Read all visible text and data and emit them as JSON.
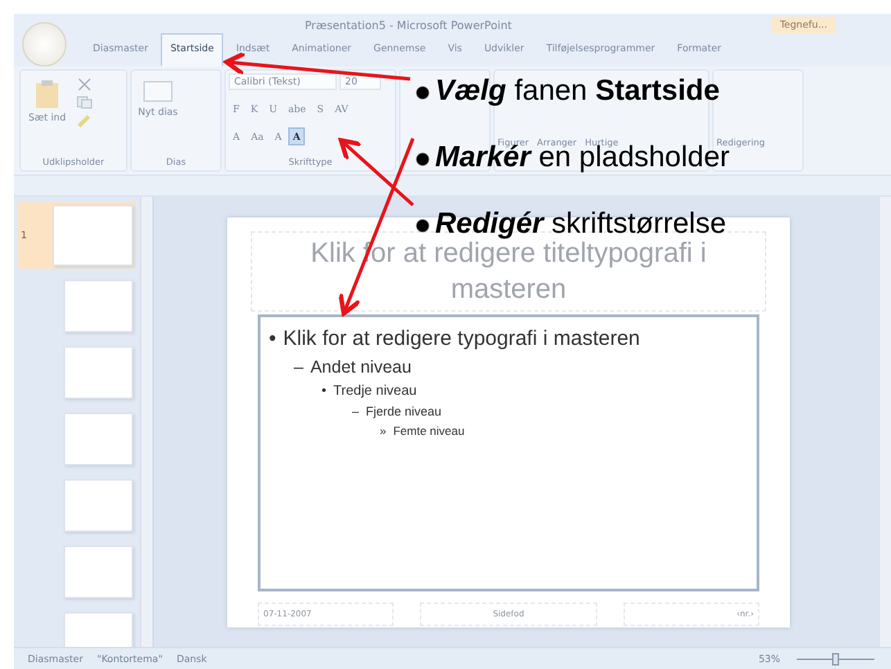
{
  "window": {
    "title": "Præsentation5 - Microsoft PowerPoint",
    "context_tab": "Tegnefu..."
  },
  "tabs": [
    {
      "label": "Diasmaster",
      "selected": false
    },
    {
      "label": "Startside",
      "selected": true
    },
    {
      "label": "Indsæt",
      "selected": false
    },
    {
      "label": "Animationer",
      "selected": false
    },
    {
      "label": "Gennemse",
      "selected": false
    },
    {
      "label": "Vis",
      "selected": false
    },
    {
      "label": "Udvikler",
      "selected": false
    },
    {
      "label": "Tilføjelsesprogrammer",
      "selected": false
    },
    {
      "label": "Formater",
      "selected": false
    }
  ],
  "ribbon": {
    "clipboard": {
      "paste": "Sæt ind",
      "group": "Udklipsholder"
    },
    "slides": {
      "new_slide": "Nyt dias",
      "group": "Dias"
    },
    "font": {
      "name": "Calibri (Tekst)",
      "size": "20",
      "group": "Skrifttype",
      "buttons": [
        {
          "label": "F",
          "selected": false
        },
        {
          "label": "K",
          "selected": false
        },
        {
          "label": "U",
          "selected": false
        },
        {
          "label": "abe",
          "selected": false
        },
        {
          "label": "S",
          "selected": false
        },
        {
          "label": "AV",
          "selected": false
        }
      ],
      "row3": [
        {
          "label": "A",
          "selected": false
        },
        {
          "label": "Aa",
          "selected": false
        },
        {
          "label": "A",
          "selected": false
        },
        {
          "label": "A",
          "selected": true
        }
      ]
    },
    "drawing": {
      "items": [
        "Figurer",
        "Arranger",
        "Hurtige"
      ]
    },
    "editing": {
      "label": "Redigering"
    }
  },
  "thumbnails": [
    {
      "number": "1",
      "selected": true
    },
    {
      "selected": false
    },
    {
      "selected": false
    },
    {
      "selected": false
    },
    {
      "selected": false
    },
    {
      "selected": false
    },
    {
      "selected": false
    }
  ],
  "slide": {
    "title": "Klik for at redigere titeltypografi i masteren",
    "levels": [
      {
        "marker": "•",
        "text": "Klik for at redigere typografi i masteren"
      },
      {
        "marker": "–",
        "text": "Andet niveau"
      },
      {
        "marker": "•",
        "text": "Tredje niveau"
      },
      {
        "marker": "–",
        "text": "Fjerde niveau"
      },
      {
        "marker": "»",
        "text": "Femte niveau"
      }
    ],
    "footer": [
      "07-11-2007",
      "Sidefod",
      "‹nr.›"
    ]
  },
  "status_bar": {
    "items": [
      "Diasmaster",
      "\"Kontortema\"",
      "Dansk"
    ],
    "zoom": "53%",
    "zoom_slider": {
      "level": 0.5
    }
  },
  "annotations": [
    {
      "verb": "Vælg",
      "rest": "fanen **Startside**"
    },
    {
      "verb": "Markér",
      "rest": "en pladsholder"
    },
    {
      "verb": "Redigér",
      "rest": "skriftstørrelse"
    }
  ]
}
